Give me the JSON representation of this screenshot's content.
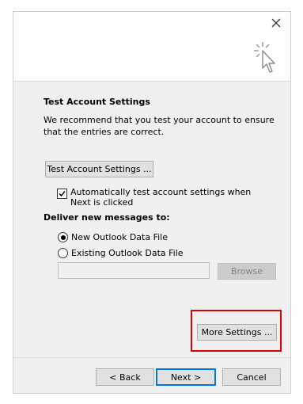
{
  "banner": {
    "close_icon": "close-icon",
    "wizard_icon": "sparkle-cursor-icon"
  },
  "test_settings": {
    "title": "Test Account Settings",
    "description": "We recommend that you test your account to ensure that the entries are correct.",
    "test_button_label": "Test Account Settings ...",
    "auto_test_checkbox": {
      "label": "Automatically test account settings when Next is clicked",
      "checked": true
    }
  },
  "delivery": {
    "label": "Deliver new messages to:",
    "options": [
      {
        "label": "New Outlook Data File",
        "selected": true
      },
      {
        "label": "Existing Outlook Data File",
        "selected": false
      }
    ],
    "path_value": "",
    "browse_label": "Browse"
  },
  "more_settings_label": "More Settings ...",
  "highlight_color": "#e00000",
  "footer": {
    "back_label": "< Back",
    "next_label": "Next >",
    "cancel_label": "Cancel"
  }
}
